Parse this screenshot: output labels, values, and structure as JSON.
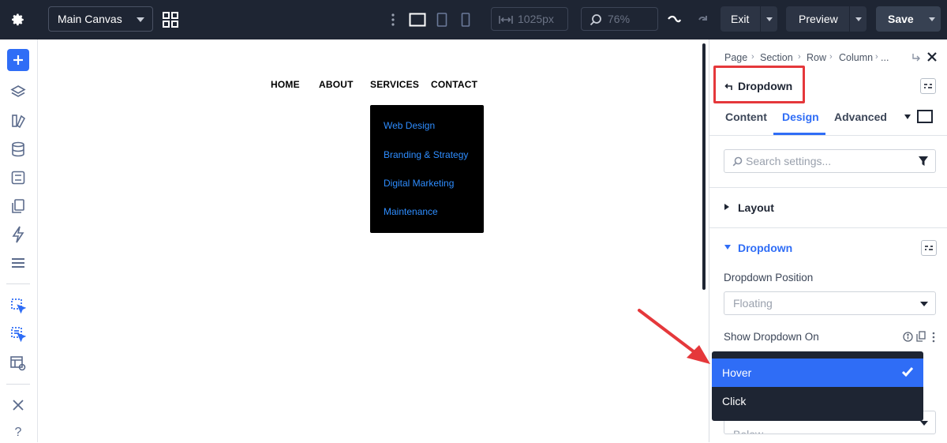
{
  "topbar": {
    "canvas_label": "Main Canvas",
    "width_value": "1025px",
    "zoom_value": "76%",
    "exit_label": "Exit",
    "preview_label": "Preview",
    "save_label": "Save"
  },
  "canvas": {
    "nav": [
      "HOME",
      "ABOUT",
      "SERVICES",
      "CONTACT"
    ],
    "submenu": [
      "Web Design",
      "Branding & Strategy",
      "Digital Marketing",
      "Maintenance"
    ]
  },
  "panel": {
    "breadcrumb": [
      "Page",
      "Section",
      "Row",
      "Column",
      "..."
    ],
    "module_title": "Dropdown",
    "tabs": [
      "Content",
      "Design",
      "Advanced"
    ],
    "active_tab": "Design",
    "search_placeholder": "Search settings...",
    "sections": {
      "layout": "Layout",
      "dropdown": "Dropdown"
    },
    "dropdown_position_label": "Dropdown Position",
    "dropdown_position_value": "Floating",
    "show_on_label": "Show Dropdown On",
    "show_on_options": [
      "Hover",
      "Click"
    ],
    "show_on_selected": "Hover",
    "next_field_value": "Below"
  },
  "colors": {
    "topbar_bg": "#1e2533",
    "accent_blue": "#2f6df6",
    "highlight_red": "#e5383b",
    "submenu_link": "#2e8dff"
  }
}
